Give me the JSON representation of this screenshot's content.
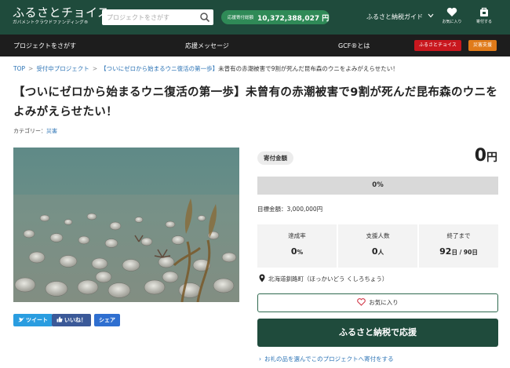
{
  "header": {
    "logo_main": "ふるさとチョイス",
    "logo_sub": "ガバメントクラウドファンディング®",
    "search_placeholder": "プロジェクトをさがす",
    "total_label": "応援寄付総額",
    "total_value": "10,372,388,027 円",
    "guide_label": "ふるさと納税ガイド",
    "favorites_label": "お気に入り",
    "history_label": "寄付する"
  },
  "nav": {
    "find_project": "プロジェクトをさがす",
    "messages": "応援メッセージ",
    "gcf": "GCF®とは",
    "choice_button": "ふるさとチョイス",
    "disaster_button": "災害支援"
  },
  "breadcrumb": {
    "top": "TOP",
    "accepting": "受付中プロジェクト",
    "current_link": "【ついにゼロから始まるウニ復活の第一歩】",
    "current_rest": "未曾有の赤潮被害で9割が死んだ昆布森のウニをよみがえらせたい！"
  },
  "project": {
    "title": "【ついにゼロから始まるウニ復活の第一歩】未曾有の赤潮被害で9割が死んだ昆布森のウニをよみがえらせたい！",
    "category_label": "カテゴリー：",
    "category_value": "災害"
  },
  "share": {
    "tweet": "ツイート",
    "like": "いいね！",
    "share": "シェア"
  },
  "donation": {
    "label": "寄付金額",
    "amount": "0",
    "unit": "円",
    "progress_text": "0%",
    "progress_fraction": 0,
    "goal": "目標金額：3,000,000円",
    "stats": [
      {
        "label": "達成率",
        "value": "0",
        "unit": "%"
      },
      {
        "label": "支援人数",
        "value": "0",
        "unit": "人"
      },
      {
        "label": "終了まで",
        "value": "92",
        "unit": "日 / 90日"
      }
    ],
    "location": "北海道釧路町（ほっかいどう くしろちょう）",
    "fav_button": "お気に入り",
    "donate_button": "ふるさと納税で応援",
    "gift_link": "お礼の品を選んでこのプロジェクトへ寄付をする"
  },
  "colors": {
    "header": "#1f4b3c",
    "accent_green": "#2f8a57",
    "nav": "#1d1d1d",
    "link": "#2b73b5"
  }
}
